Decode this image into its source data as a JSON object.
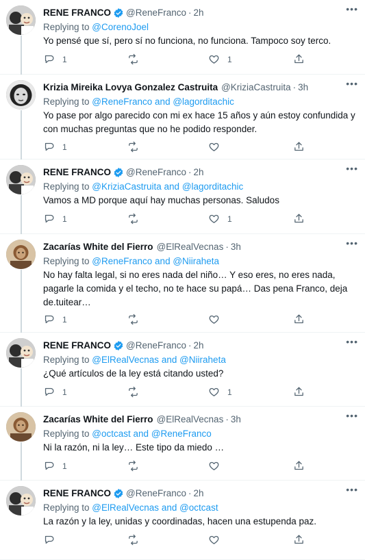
{
  "tweets": [
    {
      "name": "RENE FRANCO",
      "verified": true,
      "handle": "@ReneFranco",
      "time": "2h",
      "replying_prefix": "Replying to ",
      "replying_1": "@CorenoJoel",
      "replying_and": "",
      "replying_2": "",
      "text": "Yo pensé que sí, pero sí no funciona, no funciona. Tampoco soy terco.",
      "counts": {
        "reply": "1",
        "retweet": "",
        "like": "1"
      },
      "avatar": "rene"
    },
    {
      "name": "Krizia Mireika Lovya Gonzalez Castruita",
      "verified": false,
      "handle": "@KriziaCastruita",
      "time": "3h",
      "replying_prefix": "Replying to ",
      "replying_1": "@ReneFranco",
      "replying_and": " and ",
      "replying_2": "@lagorditachic",
      "text": "Yo pase por algo parecido con mi ex hace 15 años y aún estoy confundida y con muchas preguntas que no he podido responder.",
      "counts": {
        "reply": "1",
        "retweet": "",
        "like": ""
      },
      "avatar": "krizia"
    },
    {
      "name": "RENE FRANCO",
      "verified": true,
      "handle": "@ReneFranco",
      "time": "2h",
      "replying_prefix": "Replying to ",
      "replying_1": "@KriziaCastruita",
      "replying_and": " and ",
      "replying_2": "@lagorditachic",
      "text": "Vamos a MD porque aquí hay muchas personas. Saludos",
      "counts": {
        "reply": "1",
        "retweet": "",
        "like": "1"
      },
      "avatar": "rene"
    },
    {
      "name": "Zacarías White del Fierro",
      "verified": false,
      "handle": "@ElRealVecnas",
      "time": "3h",
      "replying_prefix": "Replying to ",
      "replying_1": "@ReneFranco",
      "replying_and": " and ",
      "replying_2": "@Niiraheta",
      "text": "No hay falta legal, si no eres nada del niño… Y eso eres, no eres nada, pagarle la comida y el techo, no te hace su papá… Das pena Franco, deja de.tuitear…",
      "counts": {
        "reply": "1",
        "retweet": "",
        "like": ""
      },
      "avatar": "zacarias"
    },
    {
      "name": "RENE FRANCO",
      "verified": true,
      "handle": "@ReneFranco",
      "time": "2h",
      "replying_prefix": "Replying to ",
      "replying_1": "@ElRealVecnas",
      "replying_and": " and ",
      "replying_2": "@Niiraheta",
      "text": "¿Qué artículos de la ley está citando usted?",
      "counts": {
        "reply": "1",
        "retweet": "",
        "like": "1"
      },
      "avatar": "rene"
    },
    {
      "name": "Zacarías White del Fierro",
      "verified": false,
      "handle": "@ElRealVecnas",
      "time": "3h",
      "replying_prefix": "Replying to ",
      "replying_1": "@octcast",
      "replying_and": " and ",
      "replying_2": "@ReneFranco",
      "text": "Ni la razón, ni la ley… Este tipo da miedo …",
      "counts": {
        "reply": "1",
        "retweet": "",
        "like": ""
      },
      "avatar": "zacarias"
    },
    {
      "name": "RENE FRANCO",
      "verified": true,
      "handle": "@ReneFranco",
      "time": "2h",
      "replying_prefix": "Replying to ",
      "replying_1": "@ElRealVecnas",
      "replying_and": " and ",
      "replying_2": "@octcast",
      "text": "La razón y la ley, unidas y coordinadas, hacen una estupenda paz.",
      "counts": {
        "reply": "",
        "retweet": "",
        "like": ""
      },
      "avatar": "rene"
    }
  ],
  "colors": {
    "accent": "#1d9bf0",
    "muted": "#536471",
    "text": "#0f1419",
    "divider": "#eff3f4",
    "thread_line": "#cfd9de"
  },
  "icons": {
    "more": "more-horizontal-icon",
    "verified": "verified-badge-icon",
    "reply": "reply-icon",
    "retweet": "retweet-icon",
    "like": "heart-icon",
    "share": "share-icon"
  },
  "labels": {
    "more": "•••"
  }
}
